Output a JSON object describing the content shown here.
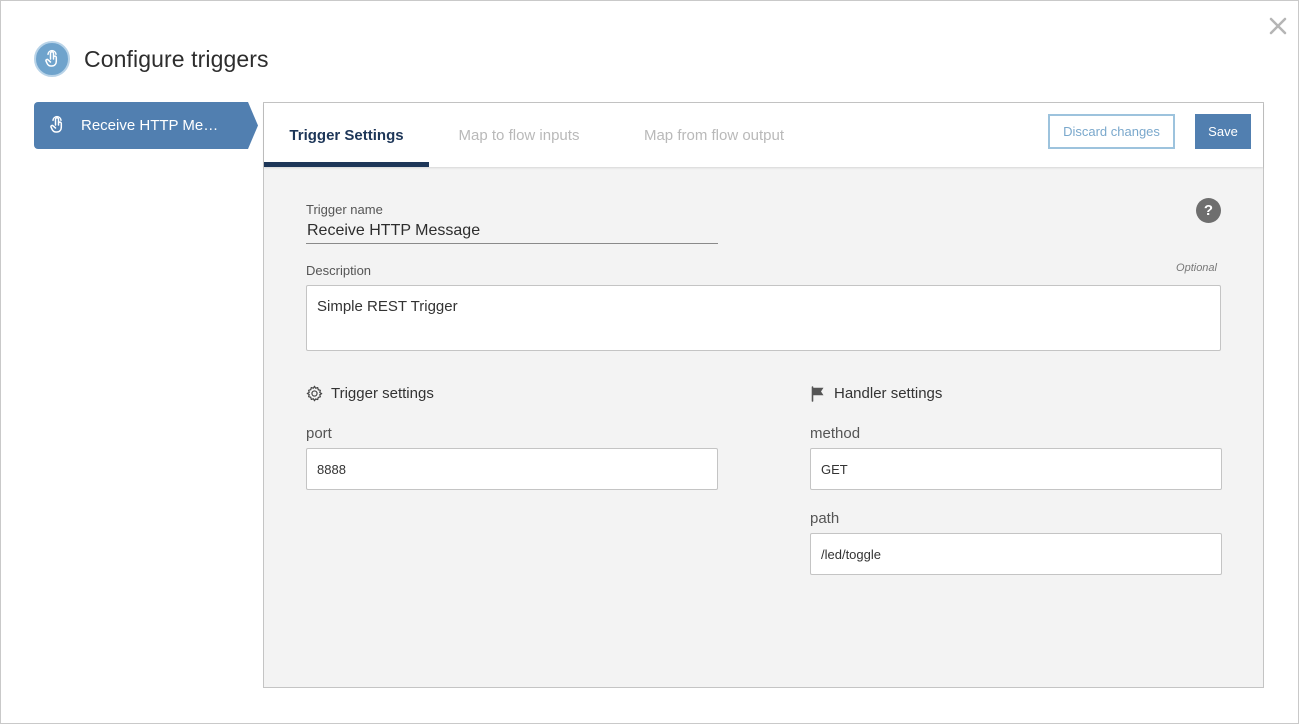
{
  "header": {
    "title": "Configure triggers",
    "icon": "touch-hand-icon",
    "icon_color": "#6fa3cc"
  },
  "close": {
    "icon": "close-icon"
  },
  "sidebar": {
    "items": [
      {
        "label": "Receive HTTP Me…",
        "icon": "touch-hand-icon",
        "selected": true,
        "color": "#517fb0"
      }
    ]
  },
  "tabs": [
    {
      "label": "Trigger Settings",
      "active": true
    },
    {
      "label": "Map to flow inputs",
      "active": false
    },
    {
      "label": "Map from flow output",
      "active": false
    }
  ],
  "toolbar": {
    "discard_label": "Discard changes",
    "save_label": "Save"
  },
  "form": {
    "trigger_name_label": "Trigger name",
    "trigger_name_value": "Receive HTTP Message",
    "help_label": "?",
    "description_label": "Description",
    "optional_label": "Optional",
    "description_value": "Simple REST Trigger"
  },
  "trigger_settings": {
    "title": "Trigger settings",
    "icon": "gear-icon",
    "port_label": "port",
    "port_value": "8888"
  },
  "handler_settings": {
    "title": "Handler settings",
    "icon": "flag-icon",
    "method_label": "method",
    "method_value": "GET",
    "path_label": "path",
    "path_value": "/led/toggle"
  }
}
